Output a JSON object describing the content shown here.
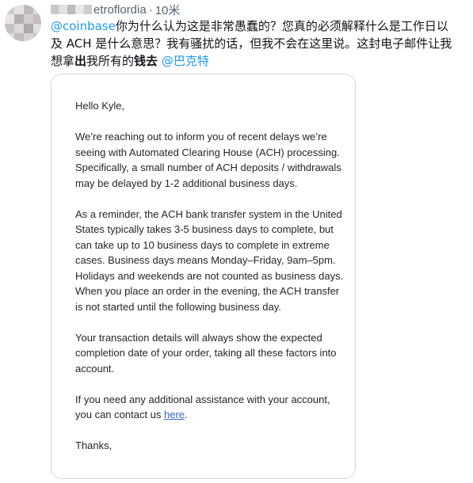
{
  "tweet": {
    "handle": "etroflordia",
    "separator": "·",
    "time": "10米",
    "mention_coinbase": "@coinbase",
    "body_part1": "你为什么认为这是非常愚蠢的？您真的必须解释什么是工作日以及 ACH 是什么意思？我有骚扰的话，但我不会在这里说。这封电子邮件让我想拿",
    "bold1": "出",
    "body_part2": "我所有的",
    "bold2": "钱去",
    "body_part3": " ",
    "mention_end": "@巴克特"
  },
  "email": {
    "greeting": "Hello Kyle,",
    "para1": "We’re reaching out to inform you of recent delays we’re seeing with Automated Clearing House (ACH) processing. Specifically, a small number of ACH deposits / withdrawals may be delayed by 1-2 additional business days.",
    "para2": "As a reminder, the ACH bank transfer system in the United States typically takes 3-5 business days to complete, but can take up to 10 business days to complete in extreme cases. Business days means Monday–Friday, 9am–5pm. Holidays and weekends are not counted as business days. When you place an order in the evening, the ACH transfer is not started until the following business day.",
    "para3": "Your transaction details will always show the expected completion date of your order, taking all these factors into account.",
    "para4_before": "If you need any additional assistance with your account, you can contact us ",
    "para4_link": "here",
    "para4_after": ".",
    "closing": "Thanks,"
  },
  "colors": {
    "link_blue": "#1d9bf0",
    "muted": "#536471",
    "card_border": "#cfd9de"
  },
  "icons": {
    "avatar": "blurred-avatar"
  }
}
